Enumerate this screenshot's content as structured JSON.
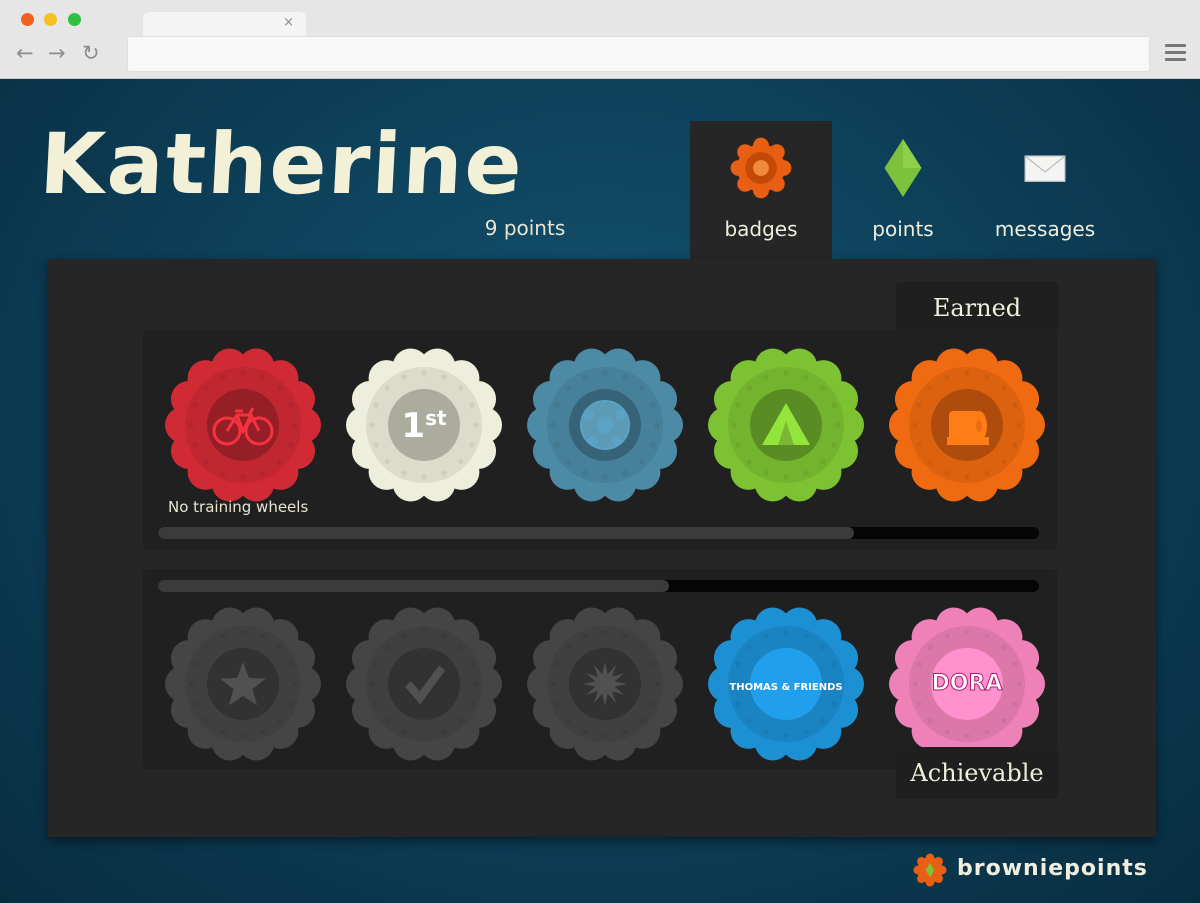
{
  "browser": {
    "tab_close": "×",
    "back_icon": "←",
    "forward_icon": "→",
    "reload_icon": "↻",
    "url": ""
  },
  "profile": {
    "name": "Katherine",
    "points_text": "9 points"
  },
  "nav": {
    "tabs": [
      {
        "label": "badges",
        "icon": "badge-icon",
        "active": true
      },
      {
        "label": "points",
        "icon": "diamond-icon",
        "active": false
      },
      {
        "label": "messages",
        "icon": "envelope-icon",
        "active": false
      }
    ]
  },
  "earned": {
    "label": "Earned",
    "caption": "No training wheels",
    "progress": 0.79,
    "badges": [
      {
        "icon": "bicycle-icon",
        "color": "#d02a35"
      },
      {
        "icon": "first-place-icon",
        "color": "#eeeedc"
      },
      {
        "icon": "soccer-ball-icon",
        "color": "#4c8aa6"
      },
      {
        "icon": "tent-icon",
        "color": "#7dc232"
      },
      {
        "icon": "toilet-paper-icon",
        "color": "#f06a12"
      }
    ]
  },
  "achievable": {
    "label": "Achievable",
    "progress": 0.58,
    "badges": [
      {
        "icon": "star-icon",
        "color": "#454545"
      },
      {
        "icon": "checkmark-icon",
        "color": "#454545"
      },
      {
        "icon": "starburst-icon",
        "color": "#454545"
      },
      {
        "icon": "thomas-and-friends-icon",
        "color": "#1d8fd3",
        "logo_text": "THOMAS & FRIENDS"
      },
      {
        "icon": "dora-explorer-icon",
        "color": "#ee82b8",
        "logo_text": "DORA"
      }
    ]
  },
  "footer": {
    "brand": "browniepoints"
  }
}
